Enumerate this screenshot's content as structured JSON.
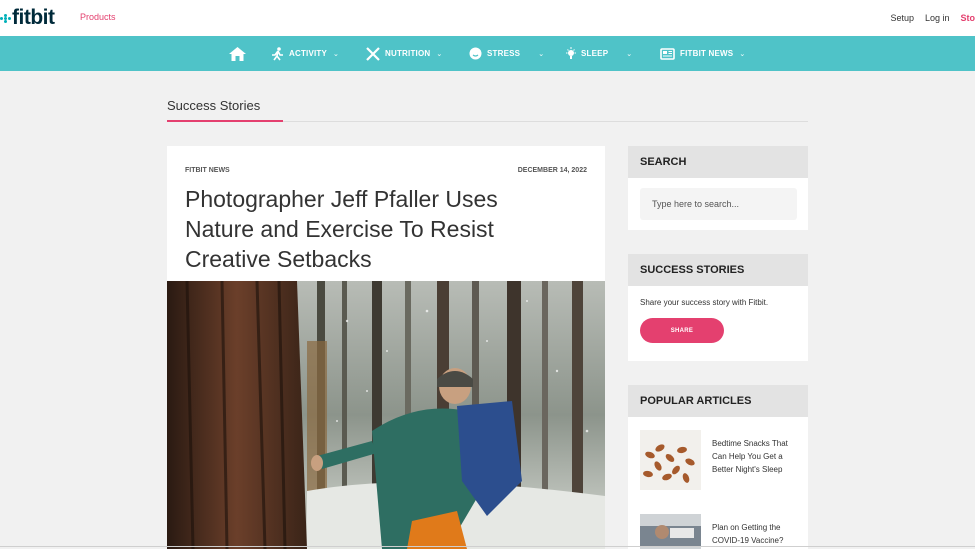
{
  "topbar": {
    "logo": "fitbit",
    "products": "Products",
    "links": {
      "setup": "Setup",
      "login": "Log in",
      "store": "Sto"
    }
  },
  "nav": {
    "items": [
      {
        "label": "",
        "icon": "home-icon"
      },
      {
        "label": "ACTIVITY",
        "icon": "running-icon"
      },
      {
        "label": "NUTRITION",
        "icon": "utensils-icon"
      },
      {
        "label": "STRESS",
        "icon": "face-icon"
      },
      {
        "label": "SLEEP",
        "icon": "lightbulb-icon"
      },
      {
        "label": "FITBIT NEWS",
        "icon": "newspaper-icon"
      }
    ],
    "chevron": "⌄"
  },
  "section": {
    "title": "Success Stories"
  },
  "article": {
    "category": "FITBIT NEWS",
    "date": "DECEMBER 14, 2022",
    "title": "Photographer Jeff Pfaller Uses Nature and Exercise To Resist Creative Setbacks"
  },
  "sidebar": {
    "search": {
      "heading": "SEARCH",
      "placeholder": "Type here to search..."
    },
    "success": {
      "heading": "SUCCESS STORIES",
      "text": "Share your success story with Fitbit.",
      "button": "SHARE"
    },
    "popular": {
      "heading": "POPULAR ARTICLES",
      "items": [
        {
          "title": "Bedtime Snacks That Can Help You Get a Better Night's Sleep"
        },
        {
          "title": "Plan on Getting the COVID-19 Vaccine?"
        }
      ]
    }
  },
  "colors": {
    "accent": "#e4406f",
    "nav": "#4fc3c8",
    "brand": "#002a3a"
  }
}
